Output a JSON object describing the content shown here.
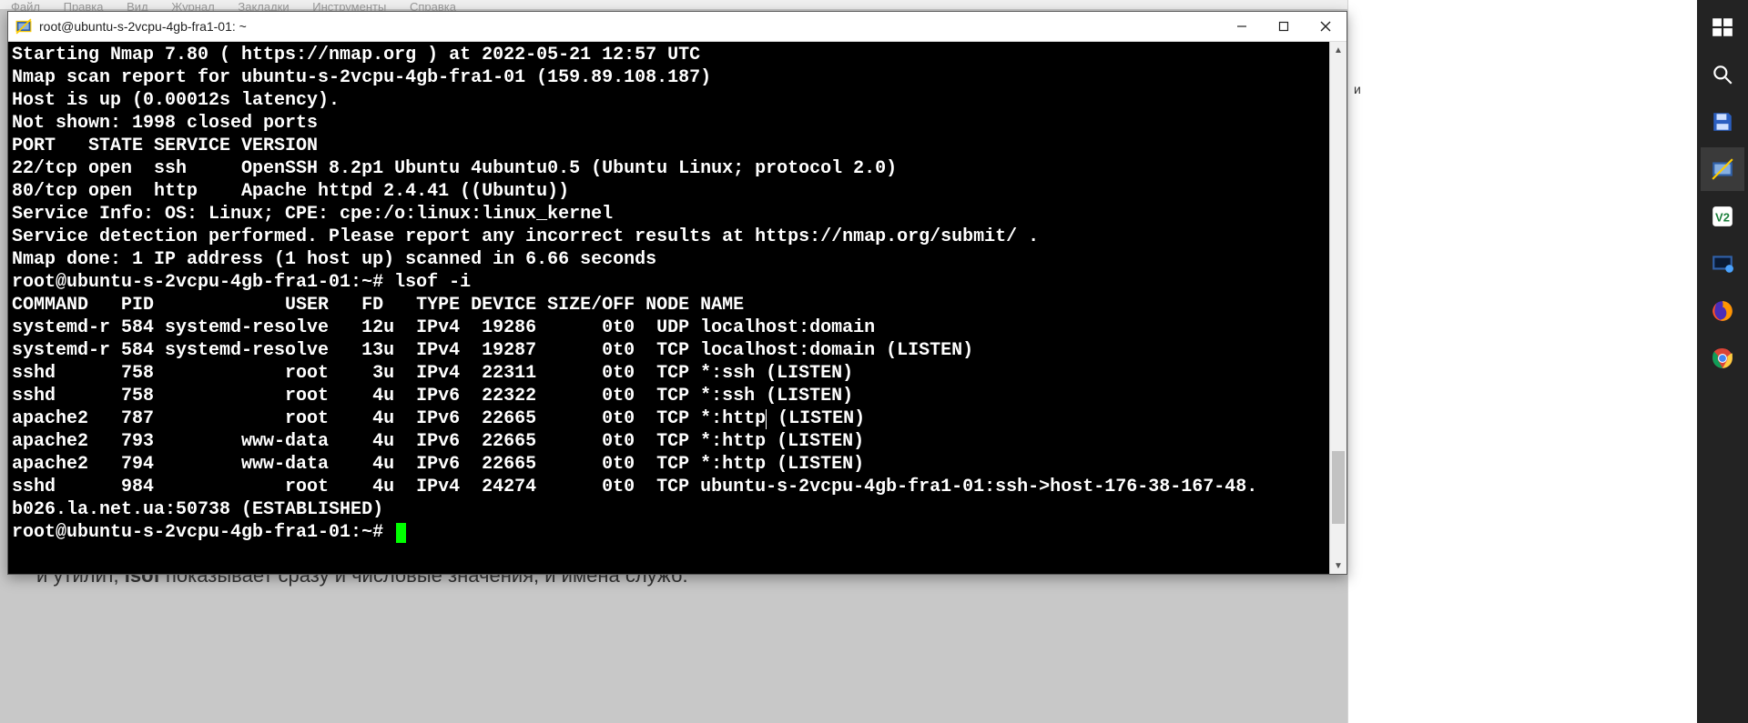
{
  "menu": {
    "items": [
      "Файл",
      "Правка",
      "Вид",
      "Журнал",
      "Закладки",
      "Инструменты",
      "Справка"
    ]
  },
  "window": {
    "title": "root@ubuntu-s-2vcpu-4gb-fra1-01: ~"
  },
  "terminal": {
    "lines": [
      "Starting Nmap 7.80 ( https://nmap.org ) at 2022-05-21 12:57 UTC",
      "Nmap scan report for ubuntu-s-2vcpu-4gb-fra1-01 (159.89.108.187)",
      "Host is up (0.00012s latency).",
      "Not shown: 1998 closed ports",
      "PORT   STATE SERVICE VERSION",
      "22/tcp open  ssh     OpenSSH 8.2p1 Ubuntu 4ubuntu0.5 (Ubuntu Linux; protocol 2.0)",
      "80/tcp open  http    Apache httpd 2.4.41 ((Ubuntu))",
      "Service Info: OS: Linux; CPE: cpe:/o:linux:linux_kernel",
      "",
      "Service detection performed. Please report any incorrect results at https://nmap.org/submit/ .",
      "Nmap done: 1 IP address (1 host up) scanned in 6.66 seconds",
      "root@ubuntu-s-2vcpu-4gb-fra1-01:~# lsof -i",
      "COMMAND   PID            USER   FD   TYPE DEVICE SIZE/OFF NODE NAME",
      "systemd-r 584 systemd-resolve   12u  IPv4  19286      0t0  UDP localhost:domain",
      "systemd-r 584 systemd-resolve   13u  IPv4  19287      0t0  TCP localhost:domain (LISTEN)",
      "sshd      758            root    3u  IPv4  22311      0t0  TCP *:ssh (LISTEN)",
      "sshd      758            root    4u  IPv6  22322      0t0  TCP *:ssh (LISTEN)",
      "apache2   787            root    4u  IPv6  22665      0t0  TCP *:http (LISTEN)",
      "apache2   793        www-data    4u  IPv6  22665      0t0  TCP *:http (LISTEN)",
      "apache2   794        www-data    4u  IPv6  22665      0t0  TCP *:http (LISTEN)",
      "sshd      984            root    4u  IPv4  24274      0t0  TCP ubuntu-s-2vcpu-4gb-fra1-01:ssh->host-176-38-167-48.",
      "b026.la.net.ua:50738 (ESTABLISHED)"
    ],
    "prompt_final": "root@ubuntu-s-2vcpu-4gb-fra1-01:~# ",
    "caret_line_index": 17
  },
  "background_doc_text_prefix": "и утилит, ",
  "background_doc_text_bold": "lsof",
  "background_doc_text_suffix": " показывает сразу и числовые значения, и имена служб.",
  "doc_edge_snippet": "и",
  "sidebar_icons": [
    "windows-icon",
    "search-icon",
    "save-icon",
    "putty-icon",
    "vnc-icon",
    "terminal-icon",
    "firefox-icon",
    "chrome-icon"
  ]
}
